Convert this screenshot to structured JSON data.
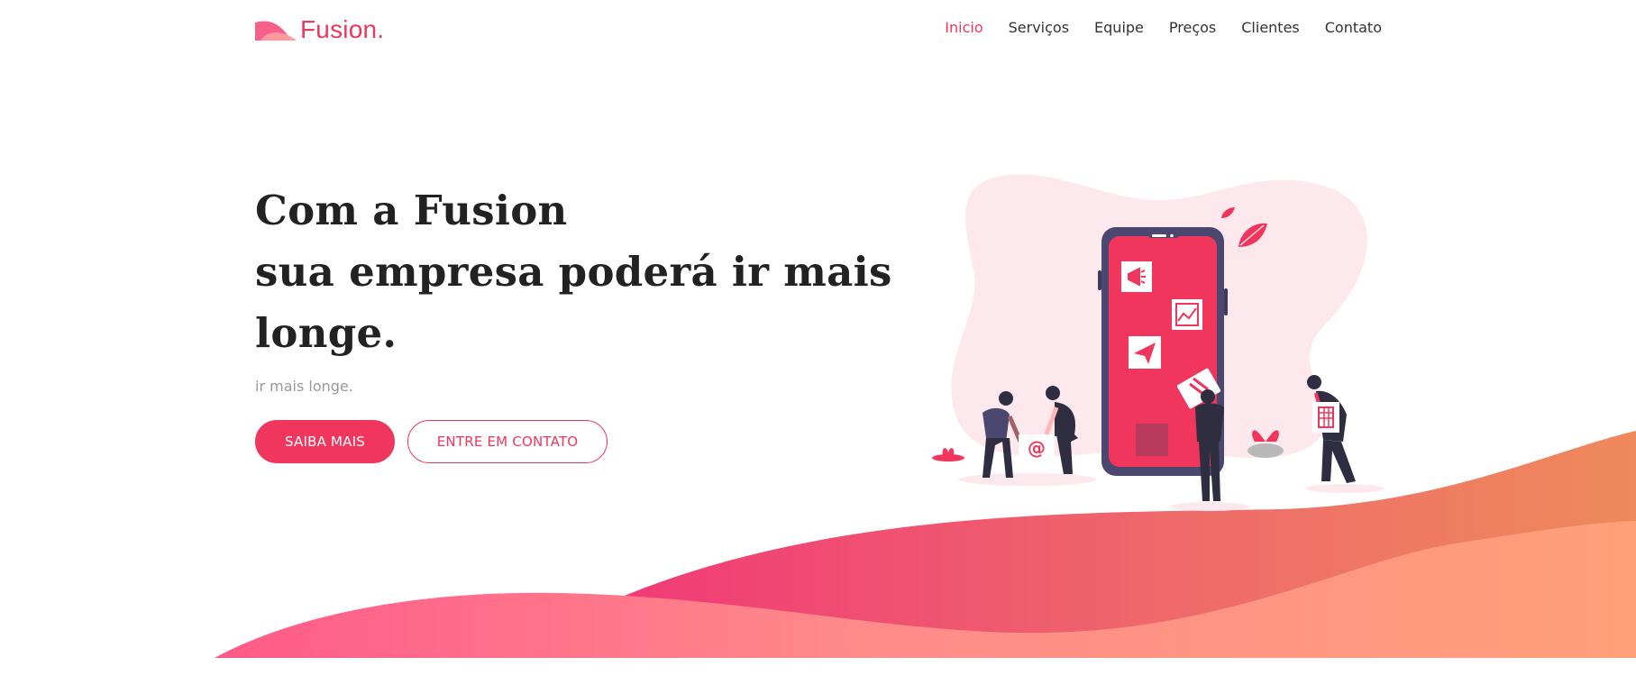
{
  "brand": {
    "name": "Fusion."
  },
  "nav": {
    "items": [
      {
        "label": "Inicio",
        "active": true
      },
      {
        "label": "Serviços",
        "active": false
      },
      {
        "label": "Equipe",
        "active": false
      },
      {
        "label": "Preços",
        "active": false
      },
      {
        "label": "Clientes",
        "active": false
      },
      {
        "label": "Contato",
        "active": false
      }
    ]
  },
  "hero": {
    "title_lines": [
      "Com a Fusion",
      "sua empresa poderá ir mais",
      "longe."
    ],
    "subtitle": "ir mais longe.",
    "primary_button": "SAIBA MAIS",
    "secondary_button": "ENTRE EM CONTATO"
  },
  "colors": {
    "accent": "#f0365c",
    "wave_start": "#f0307a",
    "wave_end": "#ffa07a",
    "phone_body": "#4b4870",
    "phone_screen": "#f0365c",
    "blob": "#fde9ed"
  },
  "icons": [
    "logo-mark-icon",
    "megaphone-icon",
    "chart-icon",
    "paper-plane-icon",
    "building-icon",
    "at-sign-icon",
    "leaf-icon"
  ]
}
